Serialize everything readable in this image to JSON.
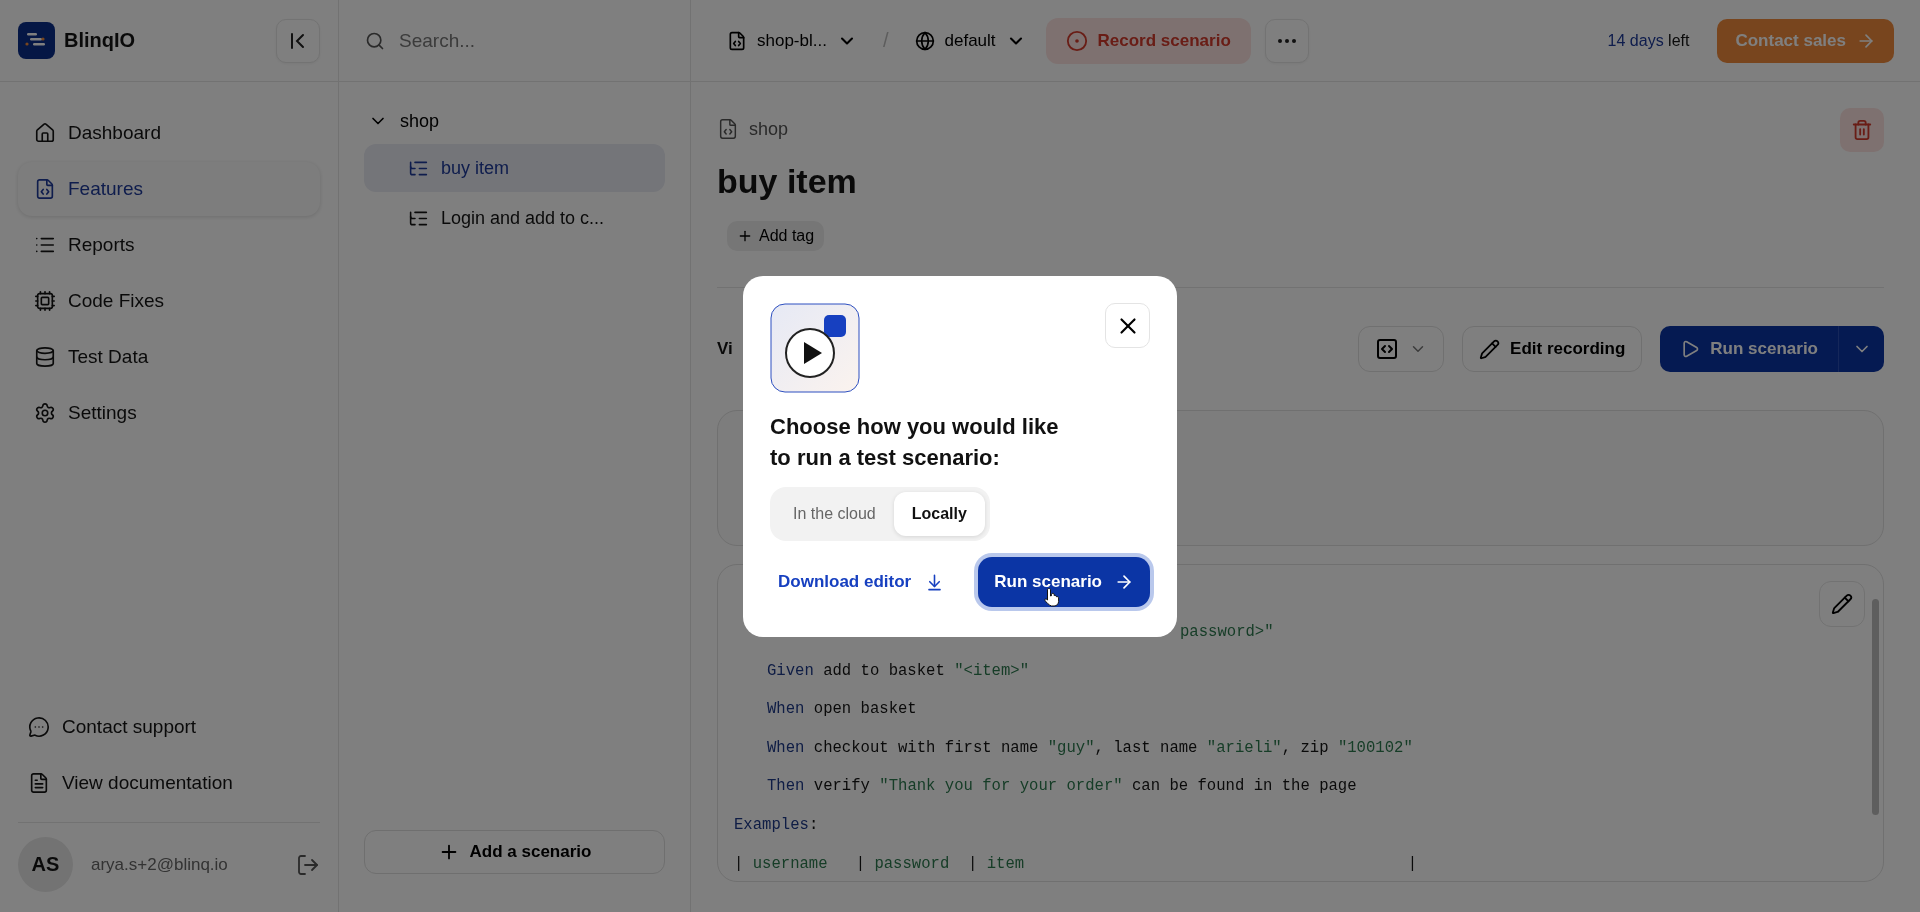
{
  "sidebar": {
    "brand": "BlinqIO",
    "nav": [
      {
        "label": "Dashboard",
        "kind": "home",
        "selected": false
      },
      {
        "label": "Features",
        "kind": "features",
        "selected": true
      },
      {
        "label": "Reports",
        "kind": "reports",
        "selected": false
      },
      {
        "label": "Code Fixes",
        "kind": "fixes",
        "selected": false
      },
      {
        "label": "Test Data",
        "kind": "data",
        "selected": false
      },
      {
        "label": "Settings",
        "kind": "settings",
        "selected": false
      }
    ],
    "footer_links": [
      {
        "label": "Contact support",
        "kind": "support"
      },
      {
        "label": "View documentation",
        "kind": "docs"
      }
    ],
    "user": {
      "initials": "AS",
      "email": "arya.s+2@blinq.io"
    }
  },
  "explorer": {
    "search": {
      "placeholder": "Search..."
    },
    "tree": [
      {
        "label": "shop",
        "expanded": true,
        "children": [
          {
            "label": "buy item",
            "selected": true
          },
          {
            "label": "Login and add to c...",
            "selected": false
          }
        ]
      }
    ],
    "add_button": "Add a scenario"
  },
  "topbar": {
    "project": "shop-bl...",
    "separator": "/",
    "environment": "default",
    "record_button": "Record scenario",
    "trial_days": "14 days",
    "trial_suffix": "left",
    "contact_button": "Contact sales"
  },
  "feature": {
    "breadcrumb": "shop",
    "title": "buy item",
    "add_tag": "Add tag",
    "view_label": "Vi",
    "edit_recording": "Edit recording",
    "run_button": "Run scenario",
    "code": [
      {
        "kind": "fragment",
        "tokens": [
          {
            "text": "password>\"",
            "kind": "string"
          }
        ]
      },
      {
        "kind": "step",
        "tokens": [
          {
            "text": "Given",
            "kind": "keyword"
          },
          {
            "text": " add to basket ",
            "kind": "plain"
          },
          {
            "text": "\"<item>\"",
            "kind": "string"
          }
        ]
      },
      {
        "kind": "step",
        "tokens": [
          {
            "text": "When",
            "kind": "keyword"
          },
          {
            "text": " open basket",
            "kind": "plain"
          }
        ]
      },
      {
        "kind": "step",
        "tokens": [
          {
            "text": "When",
            "kind": "keyword"
          },
          {
            "text": " checkout with first name ",
            "kind": "plain"
          },
          {
            "text": "\"guy\"",
            "kind": "string"
          },
          {
            "text": ", last name ",
            "kind": "plain"
          },
          {
            "text": "\"arieli\"",
            "kind": "string"
          },
          {
            "text": ", zip ",
            "kind": "plain"
          },
          {
            "text": "\"100102\"",
            "kind": "string"
          }
        ]
      },
      {
        "kind": "step",
        "tokens": [
          {
            "text": "Then",
            "kind": "keyword"
          },
          {
            "text": " verify ",
            "kind": "plain"
          },
          {
            "text": "\"Thank you for your order\"",
            "kind": "string"
          },
          {
            "text": " can be found in the page",
            "kind": "plain"
          }
        ]
      },
      {
        "kind": "section",
        "tokens": [
          {
            "text": "Examples",
            "kind": "keyword"
          },
          {
            "text": ":",
            "kind": "plain"
          }
        ]
      },
      {
        "kind": "section",
        "tokens": [
          {
            "text": "| ",
            "kind": "plain"
          },
          {
            "text": "username",
            "kind": "string"
          },
          {
            "text": "   | ",
            "kind": "plain"
          },
          {
            "text": "password",
            "kind": "string"
          },
          {
            "text": "  | ",
            "kind": "plain"
          },
          {
            "text": "item",
            "kind": "string"
          },
          {
            "text": "                                         |",
            "kind": "plain"
          }
        ]
      }
    ]
  },
  "dialog": {
    "heading": [
      "Choose how you would like",
      "to run a test scenario:"
    ],
    "options": [
      {
        "label": "In the cloud",
        "selected": false
      },
      {
        "label": "Locally",
        "selected": true
      }
    ],
    "download_link": "Download editor",
    "run_button": "Run scenario"
  }
}
